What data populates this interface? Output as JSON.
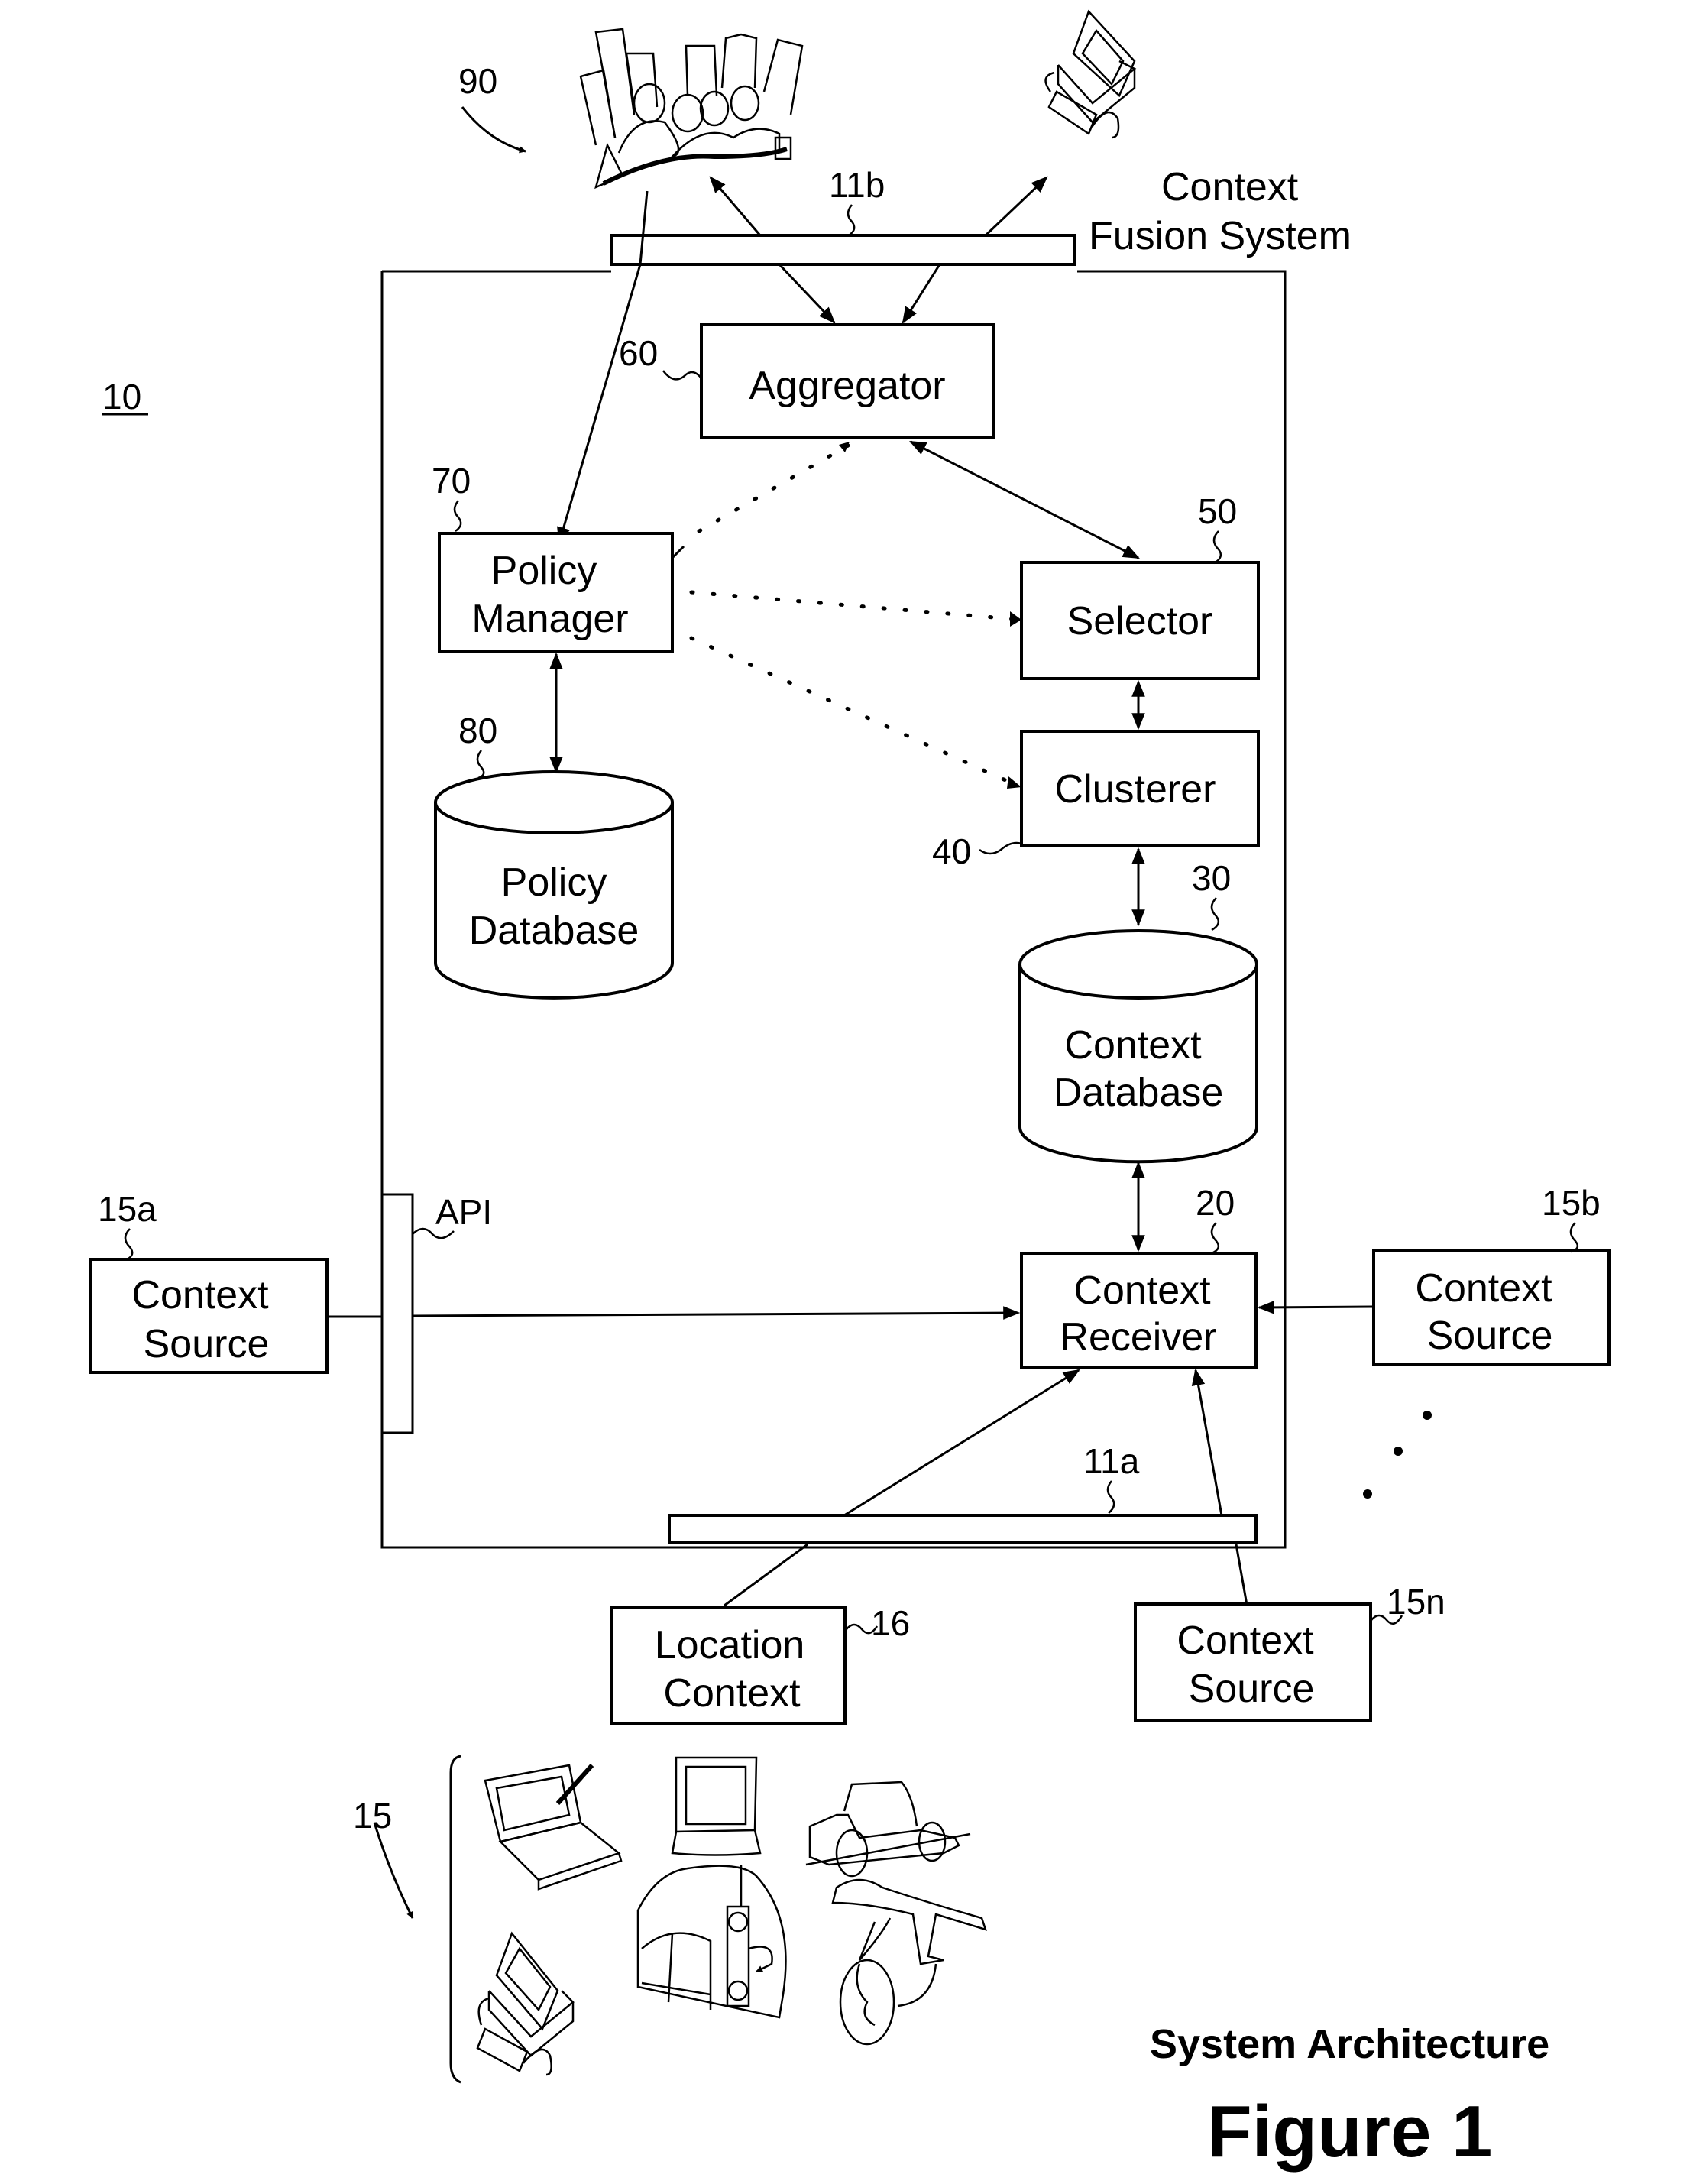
{
  "figure": {
    "system_ref": "10",
    "title": "System Architecture",
    "caption": "Figure 1",
    "system_name": [
      "Context",
      "Fusion System"
    ]
  },
  "components": {
    "aggregator": {
      "ref": "60",
      "lines": [
        "Aggregator"
      ]
    },
    "policy_manager": {
      "ref": "70",
      "lines": [
        "Policy",
        "Manager"
      ]
    },
    "selector": {
      "ref": "50",
      "lines": [
        "Selector"
      ]
    },
    "clusterer": {
      "ref": "40",
      "lines": [
        "Clusterer"
      ]
    },
    "policy_database": {
      "ref": "80",
      "lines": [
        "Policy",
        "Database"
      ]
    },
    "context_database": {
      "ref": "30",
      "lines": [
        "Context",
        "Database"
      ]
    },
    "context_receiver": {
      "ref": "20",
      "lines": [
        "Context",
        "Receiver"
      ]
    },
    "context_source_a": {
      "ref": "15a",
      "lines": [
        "Context",
        "Source"
      ]
    },
    "context_source_b": {
      "ref": "15b",
      "lines": [
        "Context",
        "Source"
      ]
    },
    "context_source_n": {
      "ref": "15n",
      "lines": [
        "Context",
        "Source"
      ]
    },
    "location_context": {
      "ref": "16",
      "lines": [
        "Location",
        "Context"
      ]
    }
  },
  "interfaces": {
    "api": {
      "label": "API"
    },
    "bus_top": {
      "ref": "11b"
    },
    "bus_bottom": {
      "ref": "11a"
    }
  },
  "clipart": {
    "users": {
      "ref": "90",
      "icon": "city-people-icon"
    },
    "terminal": {
      "icon": "desktop-computer-icon"
    },
    "devices": {
      "ref": "15",
      "icons": [
        "laptop-pen-icon",
        "pda-icon",
        "car-icon",
        "desktop-computer-icon",
        "building-cellphone-icon",
        "airplane-globe-icon"
      ]
    }
  },
  "connections": [
    {
      "from": "users",
      "to": "policy_manager",
      "style": "solid"
    },
    {
      "from": "bus_top",
      "to": "users",
      "style": "solid"
    },
    {
      "from": "bus_top",
      "to": "terminal",
      "style": "solid"
    },
    {
      "from": "bus_top",
      "to": "aggregator",
      "style": "solid",
      "count": 2
    },
    {
      "from": "aggregator",
      "to": "selector",
      "style": "solid",
      "bidirectional": true
    },
    {
      "from": "policy_manager",
      "to": "aggregator",
      "style": "dotted"
    },
    {
      "from": "policy_manager",
      "to": "selector",
      "style": "dotted"
    },
    {
      "from": "policy_manager",
      "to": "clusterer",
      "style": "dotted"
    },
    {
      "from": "policy_manager",
      "to": "policy_database",
      "style": "solid",
      "bidirectional": true
    },
    {
      "from": "selector",
      "to": "clusterer",
      "style": "solid",
      "bidirectional": true
    },
    {
      "from": "clusterer",
      "to": "context_database",
      "style": "solid",
      "bidirectional": true
    },
    {
      "from": "context_database",
      "to": "context_receiver",
      "style": "solid",
      "bidirectional": true
    },
    {
      "from": "context_source_a",
      "to": "context_receiver",
      "via": "api",
      "style": "solid"
    },
    {
      "from": "context_source_b",
      "to": "context_receiver",
      "style": "solid"
    },
    {
      "from": "location_context",
      "to": "context_receiver",
      "via": "bus_bottom",
      "style": "solid"
    },
    {
      "from": "context_source_n",
      "to": "context_receiver",
      "via": "bus_bottom",
      "style": "solid"
    }
  ]
}
